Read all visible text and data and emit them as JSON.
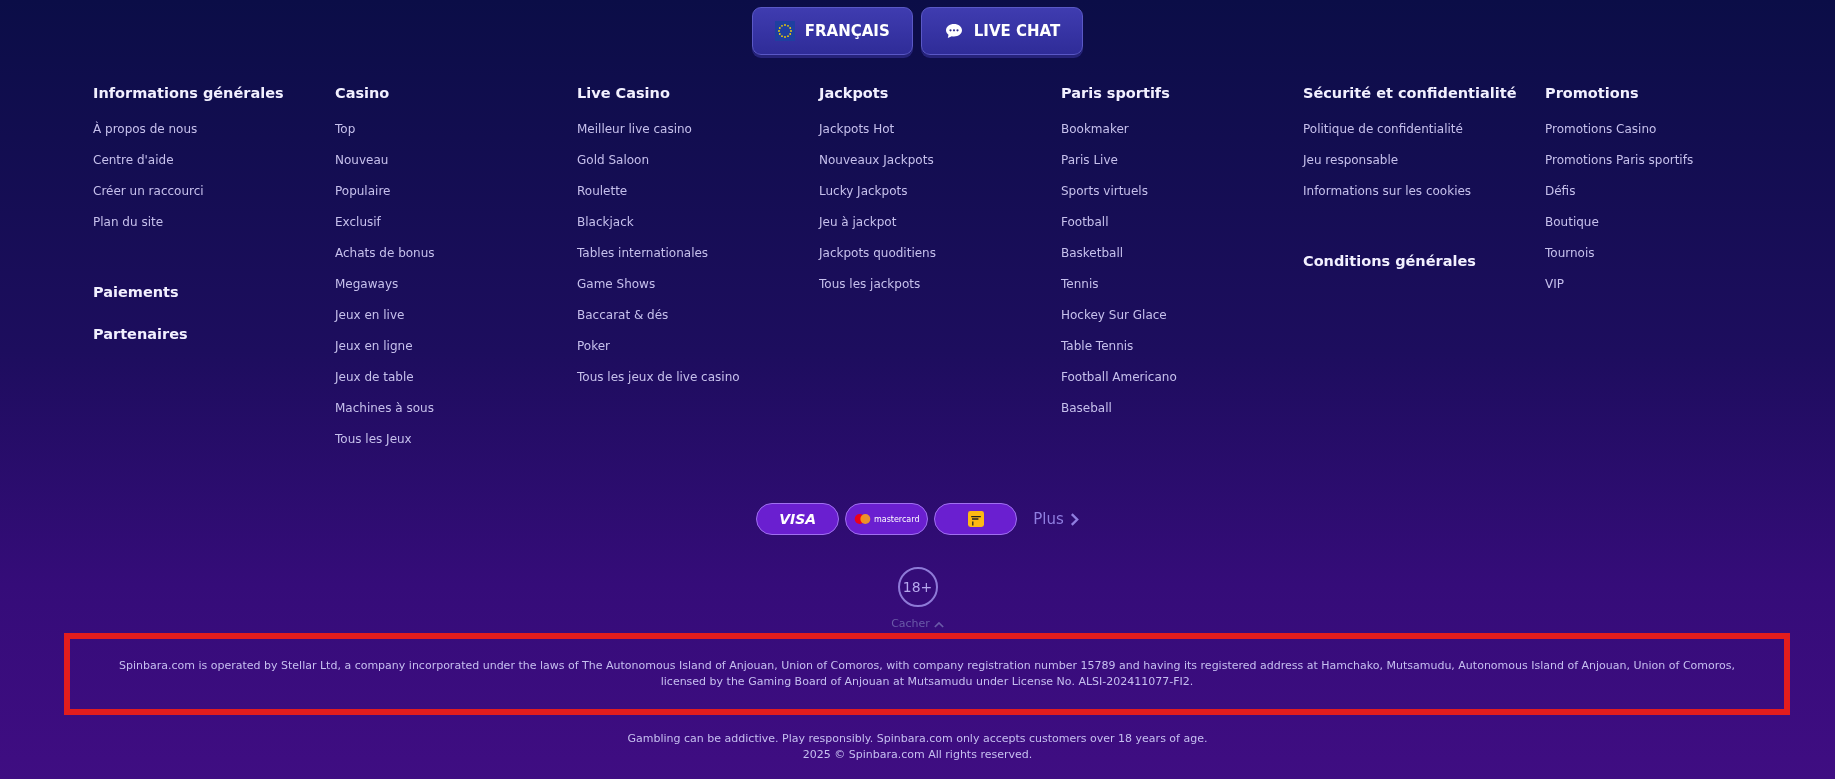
{
  "top_buttons": [
    {
      "kind": "language",
      "label": "FRANÇAIS"
    },
    {
      "kind": "chat",
      "label": "LIVE CHAT"
    }
  ],
  "columns": [
    {
      "heading": "Informations générales",
      "links": [
        "À propos de nous",
        "Centre d'aide",
        "Créer un raccourci",
        "Plan du site"
      ],
      "extra_headings": [
        "Paiements",
        "Partenaires"
      ]
    },
    {
      "heading": "Casino",
      "links": [
        "Top",
        "Nouveau",
        "Populaire",
        "Exclusif",
        "Achats de bonus",
        "Megaways",
        "Jeux en live",
        "Jeux en ligne",
        "Jeux de table",
        "Machines à sous",
        "Tous les Jeux"
      ]
    },
    {
      "heading": "Live Casino",
      "links": [
        "Meilleur live casino",
        "Gold Saloon",
        "Roulette",
        "Blackjack",
        "Tables internationales",
        "Game Shows",
        "Baccarat & dés",
        "Poker",
        "Tous les jeux de live casino"
      ]
    },
    {
      "heading": "Jackpots",
      "links": [
        "Jackpots Hot",
        "Nouveaux Jackpots",
        "Lucky Jackpots",
        "Jeu à jackpot",
        "Jackpots quoditiens",
        "Tous les jackpots"
      ]
    },
    {
      "heading": "Paris sportifs",
      "links": [
        "Bookmaker",
        "Paris Live",
        "Sports virtuels",
        "Football",
        "Basketball",
        "Tennis",
        "Hockey Sur Glace",
        "Table Tennis",
        "Football Americano",
        "Baseball"
      ]
    },
    {
      "heading": "Sécurité et confidentialité",
      "links": [
        "Politique de confidentialité",
        "Jeu responsable",
        "Informations sur les cookies"
      ],
      "extra_headings": [
        "Conditions générales"
      ]
    },
    {
      "heading": "Promotions",
      "links": [
        "Promotions Casino",
        "Promotions Paris sportifs",
        "Défis",
        "Boutique",
        "Tournois",
        "VIP"
      ]
    }
  ],
  "payment_methods": [
    {
      "kind": "visa",
      "label": "VISA"
    },
    {
      "kind": "mastercard",
      "label": "mastercard"
    },
    {
      "kind": "interac"
    }
  ],
  "more_link": "Plus",
  "age_badge": "18+",
  "hide_toggle": "Cacher",
  "legal_notice": {
    "text": "Spinbara.com is operated by Stellar Ltd, a company incorporated under the laws of The Autonomous Island of Anjouan, Union of Comoros, with company registration number 15789 and having its registered address at Hamchako, Mutsamudu, Autonomous Island of Anjouan, Union of Comoros, licensed by the Gaming Board of Anjouan at Mutsamudu under License No. ALSI-202411077-FI2.",
    "highlighted": true
  },
  "disclaimer": [
    "Gambling can be addictive. Play responsibly. Spinbara.com only accepts customers over 18 years of age.",
    "2025 © Spinbara.com All rights reserved."
  ]
}
